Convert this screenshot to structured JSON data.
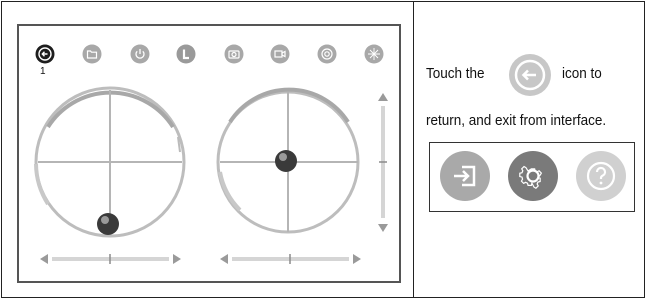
{
  "toolbar": {
    "icons": [
      {
        "name": "back-icon",
        "active": true
      },
      {
        "name": "folder-icon",
        "active": false
      },
      {
        "name": "power-icon",
        "active": false
      },
      {
        "name": "l-mode-icon",
        "active": false
      },
      {
        "name": "camera-icon",
        "active": false
      },
      {
        "name": "video-icon",
        "active": false
      },
      {
        "name": "gyro-icon",
        "active": false
      },
      {
        "name": "compass-icon",
        "active": false
      }
    ],
    "active_index_label": "1"
  },
  "instructions": {
    "line1_before": "Touch the",
    "line1_after": "icon to",
    "line2": "return, and exit from interface."
  },
  "bottom_buttons": [
    {
      "name": "exit-icon",
      "color": "#a9a9a9"
    },
    {
      "name": "settings-icon",
      "color": "#7a7a7a"
    },
    {
      "name": "help-icon",
      "color": "#d0d0d0"
    }
  ],
  "colors": {
    "icon_gray": "#a8a8a8",
    "icon_active": "#1e1e1e",
    "ring": "#bdbdbd",
    "knob": "#333333"
  }
}
